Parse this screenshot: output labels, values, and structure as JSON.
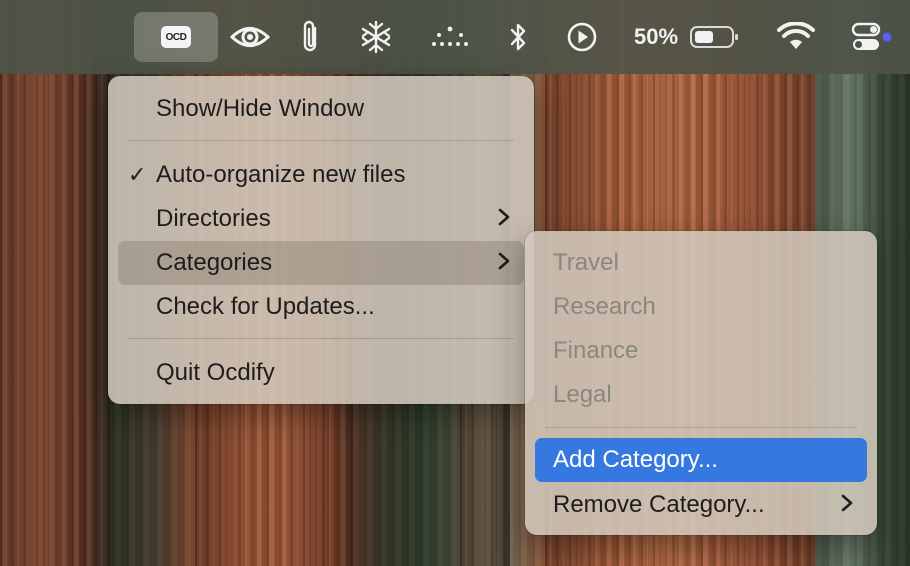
{
  "menubar": {
    "app_logo_text": "OCD",
    "battery_percent": "50%",
    "icons": [
      "ocdify-app-icon",
      "eye-icon",
      "paperclip-icon",
      "snowflake-grid-icon",
      "dots-icon",
      "bluetooth-icon",
      "play-circle-icon",
      "battery-icon",
      "wifi-icon",
      "control-center-icon"
    ],
    "accent_dot_color": "#5b5ef7"
  },
  "main_menu": {
    "items": [
      {
        "label": "Show/Hide Window"
      },
      {
        "label": "Auto-organize new files",
        "checked": true,
        "check": "✓"
      },
      {
        "label": "Directories",
        "has_submenu": true
      },
      {
        "label": "Categories",
        "has_submenu": true,
        "highlighted": true
      },
      {
        "label": "Check for Updates..."
      },
      {
        "label": "Quit Ocdify"
      }
    ]
  },
  "categories_submenu": {
    "items": [
      {
        "label": "Travel",
        "disabled": true
      },
      {
        "label": "Research",
        "disabled": true
      },
      {
        "label": "Finance",
        "disabled": true
      },
      {
        "label": "Legal",
        "disabled": true
      },
      {
        "label": "Add Category...",
        "selected": true
      },
      {
        "label": "Remove Category...",
        "has_submenu": true
      }
    ]
  },
  "colors": {
    "selection_blue": "#3478e0",
    "menu_text": "#1d1d1d",
    "disabled_text": "#8a8680"
  }
}
